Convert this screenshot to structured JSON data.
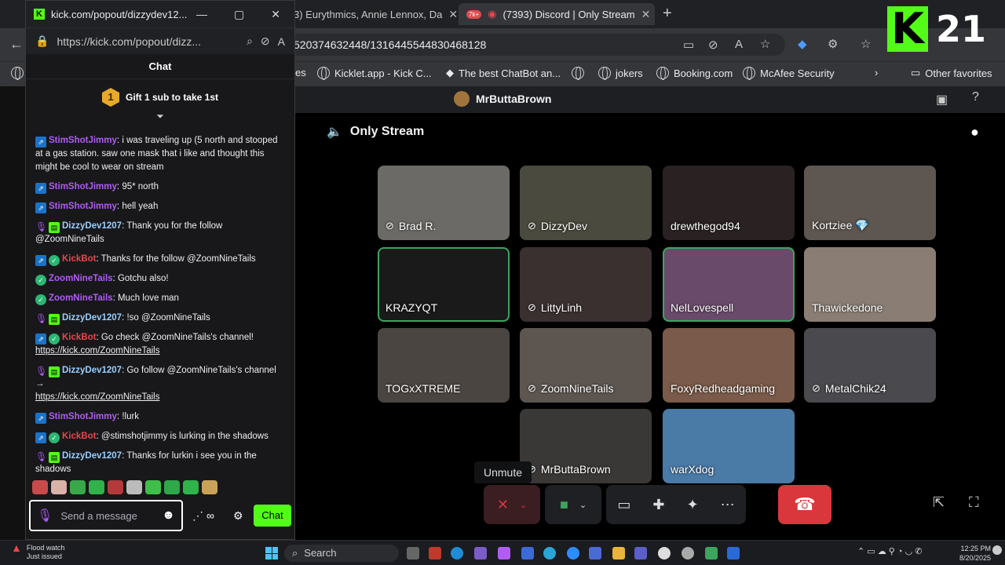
{
  "browser": {
    "tabs": [
      {
        "label": "3) Eurythmics, Annie Lennox, Da",
        "active": false
      },
      {
        "label": "(7393) Discord | Only Stream",
        "active": true
      }
    ],
    "url": "520374632448/1316445544830468128",
    "favorites": [
      {
        "label": "es"
      },
      {
        "label": "Kicklet.app - Kick C..."
      },
      {
        "label": "The best ChatBot an..."
      },
      {
        "label": ""
      },
      {
        "label": "jokers"
      },
      {
        "label": "Booking.com"
      },
      {
        "label": "McAfee Security"
      }
    ],
    "other_favorites": "Other favorites",
    "badge": "7k+"
  },
  "overlay": {
    "logo": "K",
    "number": "21"
  },
  "popout": {
    "window_title": "kick.com/popout/dizzydev12...",
    "url": "https://kick.com/popout/dizz...",
    "chat_title": "Chat",
    "gift_rank": "1",
    "gift_text": "Gift 1 sub to take 1st",
    "messages": [
      {
        "badges": [
          "blue"
        ],
        "user": "StimShotJimmy",
        "color": "#b05cf7",
        "text": "i was traveling up (5 north and stooped at a gas station. saw one mask that i like and thought this might be cool to wear on stream"
      },
      {
        "badges": [
          "blue"
        ],
        "user": "StimShotJimmy",
        "color": "#b05cf7",
        "text": "95* north"
      },
      {
        "badges": [
          "blue"
        ],
        "user": "StimShotJimmy",
        "color": "#b05cf7",
        "text": "hell yeah"
      },
      {
        "badges": [
          "purple",
          "gift"
        ],
        "user": "DizzyDev1207",
        "color": "#9ad0ff",
        "text": "Thank you for the follow @ZoomNineTails"
      },
      {
        "badges": [
          "blue",
          "green"
        ],
        "user": "KickBot",
        "color": "#e5484d",
        "text": "Thanks for the follow @ZoomNineTails"
      },
      {
        "badges": [
          "green"
        ],
        "user": "ZoomNineTails",
        "color": "#b05cf7",
        "text": "Gotchu also!"
      },
      {
        "badges": [
          "green"
        ],
        "user": "ZoomNineTails",
        "color": "#b05cf7",
        "text": "Much love man"
      },
      {
        "badges": [
          "purple",
          "gift"
        ],
        "user": "DizzyDev1207",
        "color": "#9ad0ff",
        "text": "!so @ZoomNineTails"
      },
      {
        "badges": [
          "blue",
          "green"
        ],
        "user": "KickBot",
        "color": "#e5484d",
        "text": "Go check @ZoomNineTails's channel!",
        "link": "https://kick.com/ZoomNineTails"
      },
      {
        "badges": [
          "purple",
          "gift"
        ],
        "user": "DizzyDev1207",
        "color": "#9ad0ff",
        "text": "Go follow @ZoomNineTails's channel →",
        "link": "https://kick.com/ZoomNineTails"
      },
      {
        "badges": [
          "blue"
        ],
        "user": "StimShotJimmy",
        "color": "#b05cf7",
        "text": "!lurk"
      },
      {
        "badges": [
          "blue",
          "green"
        ],
        "user": "KickBot",
        "color": "#e5484d",
        "text": "@stimshotjimmy is lurking in the shadows"
      },
      {
        "badges": [
          "purple",
          "gift"
        ],
        "user": "DizzyDev1207",
        "color": "#9ad0ff",
        "text": "Thanks for lurkin i see you in the shadows"
      }
    ],
    "input_placeholder": "Send a message",
    "chat_button": "Chat"
  },
  "discord": {
    "server": "MrButtaBrown",
    "channel": "Only Stream",
    "tiles": [
      {
        "name": "Brad R.",
        "muted": true,
        "speaking": false,
        "bg": "#6b6a66"
      },
      {
        "name": "DizzyDev",
        "muted": true,
        "speaking": false,
        "bg": "#4a4a3e"
      },
      {
        "name": "drewthegod94",
        "muted": false,
        "speaking": false,
        "bg": "#2a2222"
      },
      {
        "name": "Kortziee 💎",
        "muted": false,
        "speaking": false,
        "bg": "#5e5650"
      },
      {
        "name": "KRAZYQT",
        "muted": false,
        "speaking": true,
        "bg": "#1a1a1a"
      },
      {
        "name": "LittyLinh",
        "muted": true,
        "speaking": false,
        "bg": "#3b3030"
      },
      {
        "name": "NelLovespell",
        "muted": false,
        "speaking": true,
        "bg": "#6a4a6a"
      },
      {
        "name": "Thawickedone",
        "muted": false,
        "speaking": false,
        "bg": "#8a7e74"
      },
      {
        "name": "TOGxXTREME",
        "muted": false,
        "speaking": false,
        "bg": "#4a4540"
      },
      {
        "name": "ZoomNineTails",
        "muted": true,
        "speaking": false,
        "bg": "#5d5550"
      },
      {
        "name": "FoxyRedheadgaming",
        "muted": false,
        "speaking": false,
        "bg": "#7a5a4a"
      },
      {
        "name": "MetalChik24",
        "muted": true,
        "speaking": false,
        "bg": "#4a4a4e"
      },
      {
        "name": "MrButtaBrown",
        "muted": true,
        "speaking": false,
        "bg": "#3a3836"
      },
      {
        "name": "warXdog",
        "muted": false,
        "speaking": false,
        "bg": "#4a7aa6"
      }
    ],
    "tooltip": "Unmute"
  },
  "taskbar": {
    "weather_title": "Flood watch",
    "weather_sub": "Just issued",
    "search": "Search",
    "time": "12:25 PM",
    "date": "8/20/2025"
  }
}
